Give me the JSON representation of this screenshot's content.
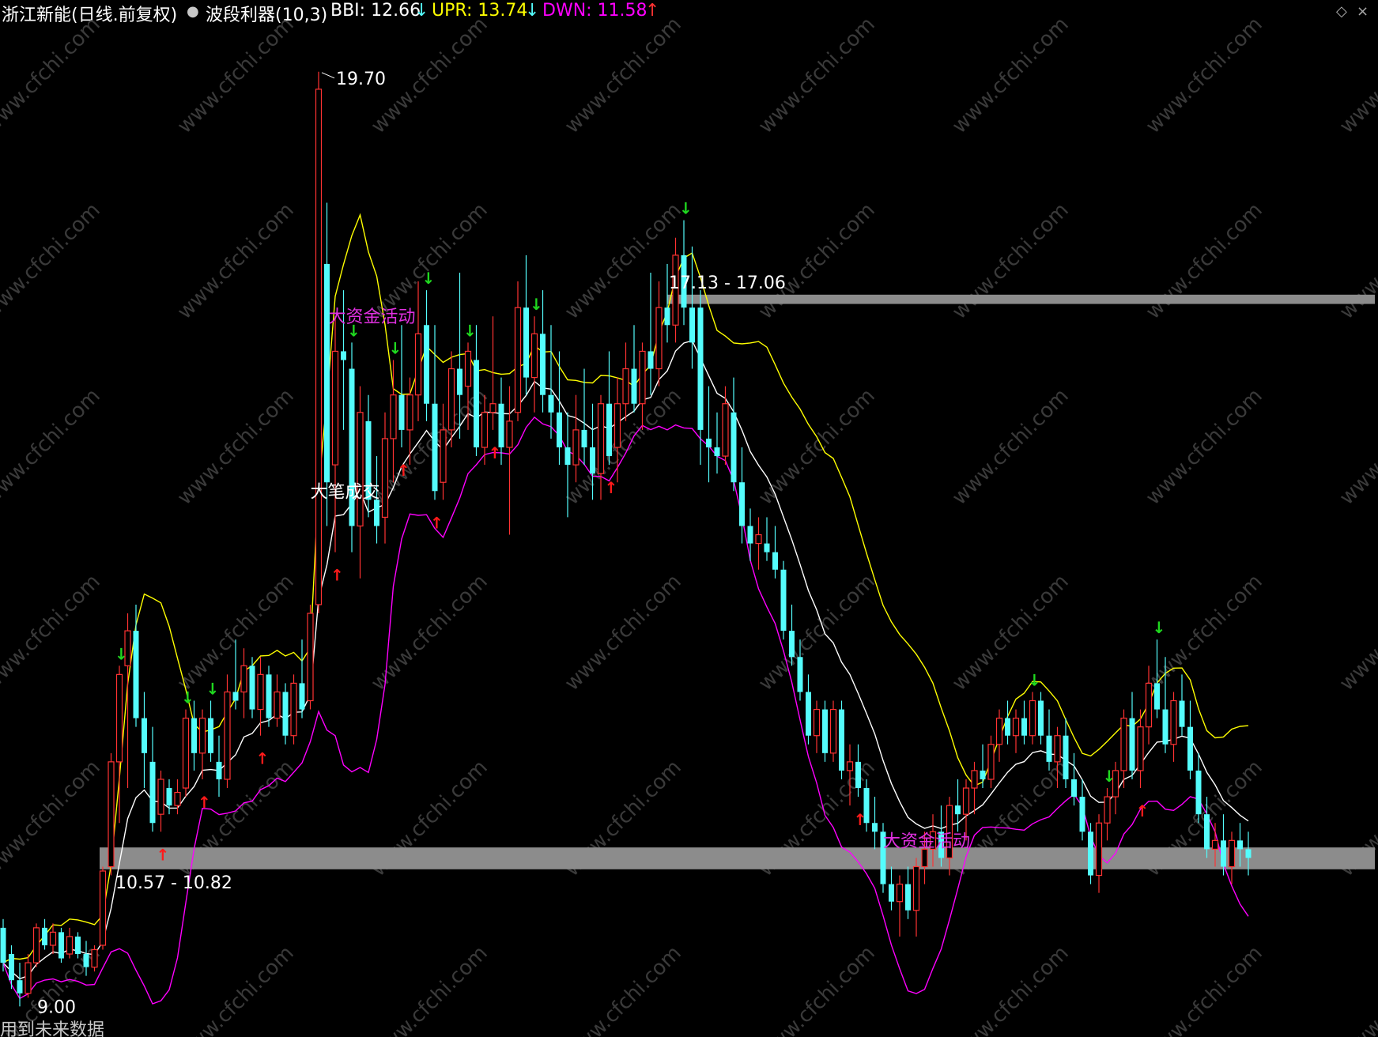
{
  "header": {
    "stock": "浙江新能(日线.前复权)",
    "indicator": "波段利器(10,3)",
    "bbi_label": "BBI: 12.66",
    "bbi_arrow": "↓",
    "upr_label": "UPR: 13.74",
    "upr_arrow": "↓",
    "dwn_label": "DWN: 11.58",
    "dwn_arrow": "↑"
  },
  "footer_text": "用到未来数据",
  "watermark": "www.cfchi.com",
  "colors": {
    "up": "#ff3232",
    "down": "#54fcfc",
    "bbi": "#ffffff",
    "upr": "#ffff00",
    "dwn": "#ff00ff",
    "buy_arrow": "#ff1a1a",
    "sell_arrow": "#1fd81f",
    "zone": "#8c8c8c",
    "big_money": "#e030e0"
  },
  "chart_data": {
    "type": "candlestick",
    "y_range": [
      8.65,
      20.25
    ],
    "annotations": {
      "max_price": "19.70",
      "min_price": "9.00",
      "resistance_zone_label": "17.13 - 17.06",
      "resistance_zone": [
        17.06,
        17.13
      ],
      "support_zone_label": "10.57 - 10.82",
      "support_zone": [
        10.57,
        10.82
      ],
      "big_money_label": "大资金活动",
      "big_volume_label": "大笔成交"
    },
    "candles": [
      {
        "o": 9.9,
        "h": 10.0,
        "l": 9.4,
        "c": 9.5
      },
      {
        "o": 9.6,
        "h": 9.7,
        "l": 9.2,
        "c": 9.3
      },
      {
        "o": 9.3,
        "h": 9.5,
        "l": 9.0,
        "c": 9.15
      },
      {
        "o": 9.15,
        "h": 9.6,
        "l": 9.1,
        "c": 9.5
      },
      {
        "o": 9.5,
        "h": 9.95,
        "l": 9.45,
        "c": 9.9
      },
      {
        "o": 9.9,
        "h": 10.0,
        "l": 9.65,
        "c": 9.7
      },
      {
        "o": 9.7,
        "h": 9.95,
        "l": 9.6,
        "c": 9.85
      },
      {
        "o": 9.85,
        "h": 9.9,
        "l": 9.5,
        "c": 9.55
      },
      {
        "o": 9.6,
        "h": 9.9,
        "l": 9.55,
        "c": 9.8
      },
      {
        "o": 9.8,
        "h": 9.85,
        "l": 9.55,
        "c": 9.6
      },
      {
        "o": 9.6,
        "h": 9.75,
        "l": 9.35,
        "c": 9.45
      },
      {
        "o": 9.45,
        "h": 9.7,
        "l": 9.4,
        "c": 9.65
      },
      {
        "o": 9.7,
        "h": 10.6,
        "l": 9.65,
        "c": 10.55
      },
      {
        "o": 10.6,
        "h": 11.9,
        "l": 10.5,
        "c": 11.8
      },
      {
        "o": 11.8,
        "h": 12.9,
        "l": 11.1,
        "c": 12.8
      },
      {
        "o": 12.9,
        "h": 13.5,
        "l": 11.5,
        "c": 13.3
      },
      {
        "o": 13.3,
        "h": 13.6,
        "l": 12.2,
        "c": 12.3
      },
      {
        "o": 12.3,
        "h": 12.6,
        "l": 11.5,
        "c": 11.9
      },
      {
        "o": 11.8,
        "h": 12.2,
        "l": 11.0,
        "c": 11.1
      },
      {
        "o": 11.2,
        "h": 11.7,
        "l": 11.0,
        "c": 11.6
      },
      {
        "o": 11.5,
        "h": 11.6,
        "l": 11.2,
        "c": 11.3
      },
      {
        "o": 11.3,
        "h": 11.6,
        "l": 11.2,
        "c": 11.45
      },
      {
        "o": 11.5,
        "h": 12.4,
        "l": 11.4,
        "c": 12.3
      },
      {
        "o": 12.3,
        "h": 12.5,
        "l": 11.7,
        "c": 11.9
      },
      {
        "o": 11.9,
        "h": 12.4,
        "l": 11.6,
        "c": 12.3
      },
      {
        "o": 12.3,
        "h": 12.5,
        "l": 11.8,
        "c": 11.9
      },
      {
        "o": 11.8,
        "h": 12.1,
        "l": 11.4,
        "c": 11.6
      },
      {
        "o": 11.6,
        "h": 12.8,
        "l": 11.5,
        "c": 12.6
      },
      {
        "o": 12.6,
        "h": 13.2,
        "l": 12.4,
        "c": 12.5
      },
      {
        "o": 12.6,
        "h": 13.1,
        "l": 12.3,
        "c": 12.9
      },
      {
        "o": 12.9,
        "h": 13.0,
        "l": 12.3,
        "c": 12.4
      },
      {
        "o": 12.4,
        "h": 13.0,
        "l": 12.1,
        "c": 12.8
      },
      {
        "o": 12.8,
        "h": 12.9,
        "l": 12.2,
        "c": 12.3
      },
      {
        "o": 12.3,
        "h": 12.8,
        "l": 12.2,
        "c": 12.6
      },
      {
        "o": 12.6,
        "h": 12.7,
        "l": 12.0,
        "c": 12.1
      },
      {
        "o": 12.1,
        "h": 12.8,
        "l": 12.0,
        "c": 12.7
      },
      {
        "o": 12.7,
        "h": 13.2,
        "l": 12.3,
        "c": 12.4
      },
      {
        "o": 12.5,
        "h": 13.6,
        "l": 12.4,
        "c": 13.5
      },
      {
        "o": 13.6,
        "h": 19.7,
        "l": 13.5,
        "c": 19.5
      },
      {
        "o": 17.5,
        "h": 18.2,
        "l": 14.5,
        "c": 15.0
      },
      {
        "o": 15.2,
        "h": 16.9,
        "l": 14.2,
        "c": 16.5
      },
      {
        "o": 16.5,
        "h": 17.2,
        "l": 15.6,
        "c": 16.4
      },
      {
        "o": 16.3,
        "h": 16.6,
        "l": 14.2,
        "c": 14.5
      },
      {
        "o": 14.5,
        "h": 16.1,
        "l": 13.9,
        "c": 15.8
      },
      {
        "o": 15.7,
        "h": 16.0,
        "l": 14.6,
        "c": 14.8
      },
      {
        "o": 14.8,
        "h": 15.3,
        "l": 14.3,
        "c": 14.5
      },
      {
        "o": 14.6,
        "h": 15.8,
        "l": 14.3,
        "c": 15.5
      },
      {
        "o": 15.5,
        "h": 16.4,
        "l": 15.0,
        "c": 16.0
      },
      {
        "o": 16.0,
        "h": 16.8,
        "l": 15.4,
        "c": 15.6
      },
      {
        "o": 15.6,
        "h": 16.2,
        "l": 15.2,
        "c": 16.0
      },
      {
        "o": 16.0,
        "h": 17.3,
        "l": 15.7,
        "c": 16.7
      },
      {
        "o": 16.8,
        "h": 17.2,
        "l": 15.7,
        "c": 15.9
      },
      {
        "o": 15.9,
        "h": 16.8,
        "l": 14.8,
        "c": 14.9
      },
      {
        "o": 15.0,
        "h": 15.9,
        "l": 14.8,
        "c": 15.6
      },
      {
        "o": 15.6,
        "h": 16.5,
        "l": 15.4,
        "c": 16.3
      },
      {
        "o": 16.3,
        "h": 17.4,
        "l": 15.5,
        "c": 16.0
      },
      {
        "o": 16.1,
        "h": 16.6,
        "l": 15.6,
        "c": 16.5
      },
      {
        "o": 16.4,
        "h": 16.8,
        "l": 15.3,
        "c": 15.4
      },
      {
        "o": 15.4,
        "h": 16.0,
        "l": 15.2,
        "c": 15.8
      },
      {
        "o": 15.8,
        "h": 16.9,
        "l": 15.6,
        "c": 15.9
      },
      {
        "o": 15.9,
        "h": 16.2,
        "l": 15.2,
        "c": 15.4
      },
      {
        "o": 15.4,
        "h": 16.1,
        "l": 14.4,
        "c": 15.7
      },
      {
        "o": 15.8,
        "h": 17.3,
        "l": 15.7,
        "c": 17.0
      },
      {
        "o": 17.0,
        "h": 17.6,
        "l": 16.0,
        "c": 16.2
      },
      {
        "o": 16.2,
        "h": 16.9,
        "l": 15.8,
        "c": 16.7
      },
      {
        "o": 16.7,
        "h": 17.2,
        "l": 15.8,
        "c": 16.0
      },
      {
        "o": 16.0,
        "h": 16.8,
        "l": 15.5,
        "c": 15.8
      },
      {
        "o": 15.8,
        "h": 16.5,
        "l": 15.2,
        "c": 15.4
      },
      {
        "o": 15.4,
        "h": 15.8,
        "l": 14.6,
        "c": 15.2
      },
      {
        "o": 15.2,
        "h": 16.0,
        "l": 15.0,
        "c": 15.6
      },
      {
        "o": 15.6,
        "h": 16.3,
        "l": 15.2,
        "c": 15.4
      },
      {
        "o": 15.4,
        "h": 15.9,
        "l": 14.8,
        "c": 15.1
      },
      {
        "o": 15.1,
        "h": 16.0,
        "l": 14.8,
        "c": 15.9
      },
      {
        "o": 15.9,
        "h": 16.5,
        "l": 15.2,
        "c": 15.3
      },
      {
        "o": 15.4,
        "h": 16.2,
        "l": 15.0,
        "c": 15.9
      },
      {
        "o": 15.9,
        "h": 16.6,
        "l": 15.7,
        "c": 16.3
      },
      {
        "o": 16.3,
        "h": 16.8,
        "l": 15.8,
        "c": 15.9
      },
      {
        "o": 15.9,
        "h": 16.6,
        "l": 15.6,
        "c": 16.5
      },
      {
        "o": 16.5,
        "h": 17.4,
        "l": 16.0,
        "c": 16.3
      },
      {
        "o": 16.3,
        "h": 17.3,
        "l": 16.1,
        "c": 17.0
      },
      {
        "o": 17.0,
        "h": 17.5,
        "l": 16.6,
        "c": 16.8
      },
      {
        "o": 16.8,
        "h": 17.8,
        "l": 16.6,
        "c": 17.6
      },
      {
        "o": 17.6,
        "h": 18.0,
        "l": 16.8,
        "c": 17.0
      },
      {
        "o": 17.0,
        "h": 17.7,
        "l": 16.3,
        "c": 16.6
      },
      {
        "o": 17.0,
        "h": 17.2,
        "l": 15.2,
        "c": 15.6
      },
      {
        "o": 15.5,
        "h": 16.1,
        "l": 15.0,
        "c": 15.4
      },
      {
        "o": 15.4,
        "h": 15.8,
        "l": 15.1,
        "c": 15.3
      },
      {
        "o": 15.3,
        "h": 16.1,
        "l": 15.2,
        "c": 15.9
      },
      {
        "o": 15.8,
        "h": 16.2,
        "l": 14.9,
        "c": 15.0
      },
      {
        "o": 15.0,
        "h": 15.4,
        "l": 14.3,
        "c": 14.5
      },
      {
        "o": 14.5,
        "h": 14.7,
        "l": 14.1,
        "c": 14.3
      },
      {
        "o": 14.3,
        "h": 14.6,
        "l": 14.0,
        "c": 14.4
      },
      {
        "o": 14.3,
        "h": 14.6,
        "l": 14.1,
        "c": 14.2
      },
      {
        "o": 14.2,
        "h": 14.5,
        "l": 13.9,
        "c": 14.0
      },
      {
        "o": 14.0,
        "h": 14.1,
        "l": 13.2,
        "c": 13.3
      },
      {
        "o": 13.3,
        "h": 13.6,
        "l": 12.9,
        "c": 13.0
      },
      {
        "o": 13.0,
        "h": 13.2,
        "l": 12.5,
        "c": 12.6
      },
      {
        "o": 12.6,
        "h": 12.8,
        "l": 12.0,
        "c": 12.1
      },
      {
        "o": 12.1,
        "h": 12.5,
        "l": 11.9,
        "c": 12.4
      },
      {
        "o": 12.4,
        "h": 12.5,
        "l": 11.8,
        "c": 11.9
      },
      {
        "o": 11.9,
        "h": 12.5,
        "l": 11.8,
        "c": 12.4
      },
      {
        "o": 12.4,
        "h": 12.5,
        "l": 11.6,
        "c": 11.7
      },
      {
        "o": 11.7,
        "h": 12.0,
        "l": 11.3,
        "c": 11.8
      },
      {
        "o": 11.8,
        "h": 12.0,
        "l": 11.4,
        "c": 11.5
      },
      {
        "o": 11.5,
        "h": 11.6,
        "l": 11.0,
        "c": 11.1
      },
      {
        "o": 11.1,
        "h": 11.4,
        "l": 10.8,
        "c": 11.0
      },
      {
        "o": 11.0,
        "h": 11.1,
        "l": 10.3,
        "c": 10.4
      },
      {
        "o": 10.4,
        "h": 10.6,
        "l": 10.1,
        "c": 10.2
      },
      {
        "o": 10.2,
        "h": 10.5,
        "l": 9.8,
        "c": 10.4
      },
      {
        "o": 10.4,
        "h": 10.6,
        "l": 10.0,
        "c": 10.1
      },
      {
        "o": 10.1,
        "h": 10.7,
        "l": 9.8,
        "c": 10.6
      },
      {
        "o": 10.6,
        "h": 11.0,
        "l": 10.4,
        "c": 10.8
      },
      {
        "o": 10.8,
        "h": 11.2,
        "l": 10.6,
        "c": 11.0
      },
      {
        "o": 11.0,
        "h": 11.3,
        "l": 10.6,
        "c": 10.7
      },
      {
        "o": 10.7,
        "h": 11.4,
        "l": 10.5,
        "c": 11.3
      },
      {
        "o": 11.3,
        "h": 11.6,
        "l": 11.0,
        "c": 11.2
      },
      {
        "o": 11.2,
        "h": 11.6,
        "l": 10.9,
        "c": 11.5
      },
      {
        "o": 11.5,
        "h": 11.8,
        "l": 11.2,
        "c": 11.7
      },
      {
        "o": 11.7,
        "h": 12.0,
        "l": 11.5,
        "c": 11.6
      },
      {
        "o": 11.6,
        "h": 12.1,
        "l": 11.5,
        "c": 12.0
      },
      {
        "o": 12.0,
        "h": 12.4,
        "l": 11.8,
        "c": 12.3
      },
      {
        "o": 12.3,
        "h": 12.5,
        "l": 12.0,
        "c": 12.1
      },
      {
        "o": 12.1,
        "h": 12.4,
        "l": 11.9,
        "c": 12.3
      },
      {
        "o": 12.3,
        "h": 12.5,
        "l": 12.0,
        "c": 12.1
      },
      {
        "o": 12.1,
        "h": 12.6,
        "l": 12.0,
        "c": 12.5
      },
      {
        "o": 12.5,
        "h": 12.6,
        "l": 12.0,
        "c": 12.1
      },
      {
        "o": 12.1,
        "h": 12.4,
        "l": 11.7,
        "c": 11.8
      },
      {
        "o": 11.8,
        "h": 12.2,
        "l": 11.5,
        "c": 12.1
      },
      {
        "o": 12.1,
        "h": 12.3,
        "l": 11.5,
        "c": 11.6
      },
      {
        "o": 11.6,
        "h": 11.9,
        "l": 11.3,
        "c": 11.4
      },
      {
        "o": 11.4,
        "h": 11.6,
        "l": 10.9,
        "c": 11.0
      },
      {
        "o": 11.0,
        "h": 11.1,
        "l": 10.4,
        "c": 10.5
      },
      {
        "o": 10.5,
        "h": 11.2,
        "l": 10.3,
        "c": 11.1
      },
      {
        "o": 11.1,
        "h": 11.5,
        "l": 10.9,
        "c": 11.4
      },
      {
        "o": 11.4,
        "h": 11.8,
        "l": 11.2,
        "c": 11.7
      },
      {
        "o": 11.7,
        "h": 12.4,
        "l": 11.5,
        "c": 12.3
      },
      {
        "o": 12.3,
        "h": 12.6,
        "l": 11.6,
        "c": 11.7
      },
      {
        "o": 11.7,
        "h": 12.4,
        "l": 11.5,
        "c": 12.2
      },
      {
        "o": 12.2,
        "h": 12.9,
        "l": 12.0,
        "c": 12.7
      },
      {
        "o": 12.7,
        "h": 13.2,
        "l": 12.3,
        "c": 12.4
      },
      {
        "o": 12.4,
        "h": 13.0,
        "l": 11.9,
        "c": 12.0
      },
      {
        "o": 12.0,
        "h": 12.6,
        "l": 11.8,
        "c": 12.5
      },
      {
        "o": 12.5,
        "h": 12.8,
        "l": 12.1,
        "c": 12.2
      },
      {
        "o": 12.2,
        "h": 12.5,
        "l": 11.6,
        "c": 11.7
      },
      {
        "o": 11.7,
        "h": 11.9,
        "l": 11.1,
        "c": 11.2
      },
      {
        "o": 11.2,
        "h": 11.4,
        "l": 10.7,
        "c": 10.8
      },
      {
        "o": 10.8,
        "h": 11.1,
        "l": 10.6,
        "c": 10.9
      },
      {
        "o": 10.9,
        "h": 11.2,
        "l": 10.5,
        "c": 10.6
      },
      {
        "o": 10.6,
        "h": 11.0,
        "l": 10.4,
        "c": 10.9
      },
      {
        "o": 10.9,
        "h": 11.1,
        "l": 10.6,
        "c": 10.8
      },
      {
        "o": 10.8,
        "h": 11.0,
        "l": 10.5,
        "c": 10.7
      }
    ],
    "signals": {
      "buy_arrows": [
        19,
        24,
        31,
        40,
        48,
        52,
        59,
        73,
        103,
        137,
        153
      ],
      "sell_arrows": [
        14,
        25,
        22,
        42,
        47,
        51,
        56,
        64,
        82,
        124,
        133,
        139
      ]
    }
  }
}
